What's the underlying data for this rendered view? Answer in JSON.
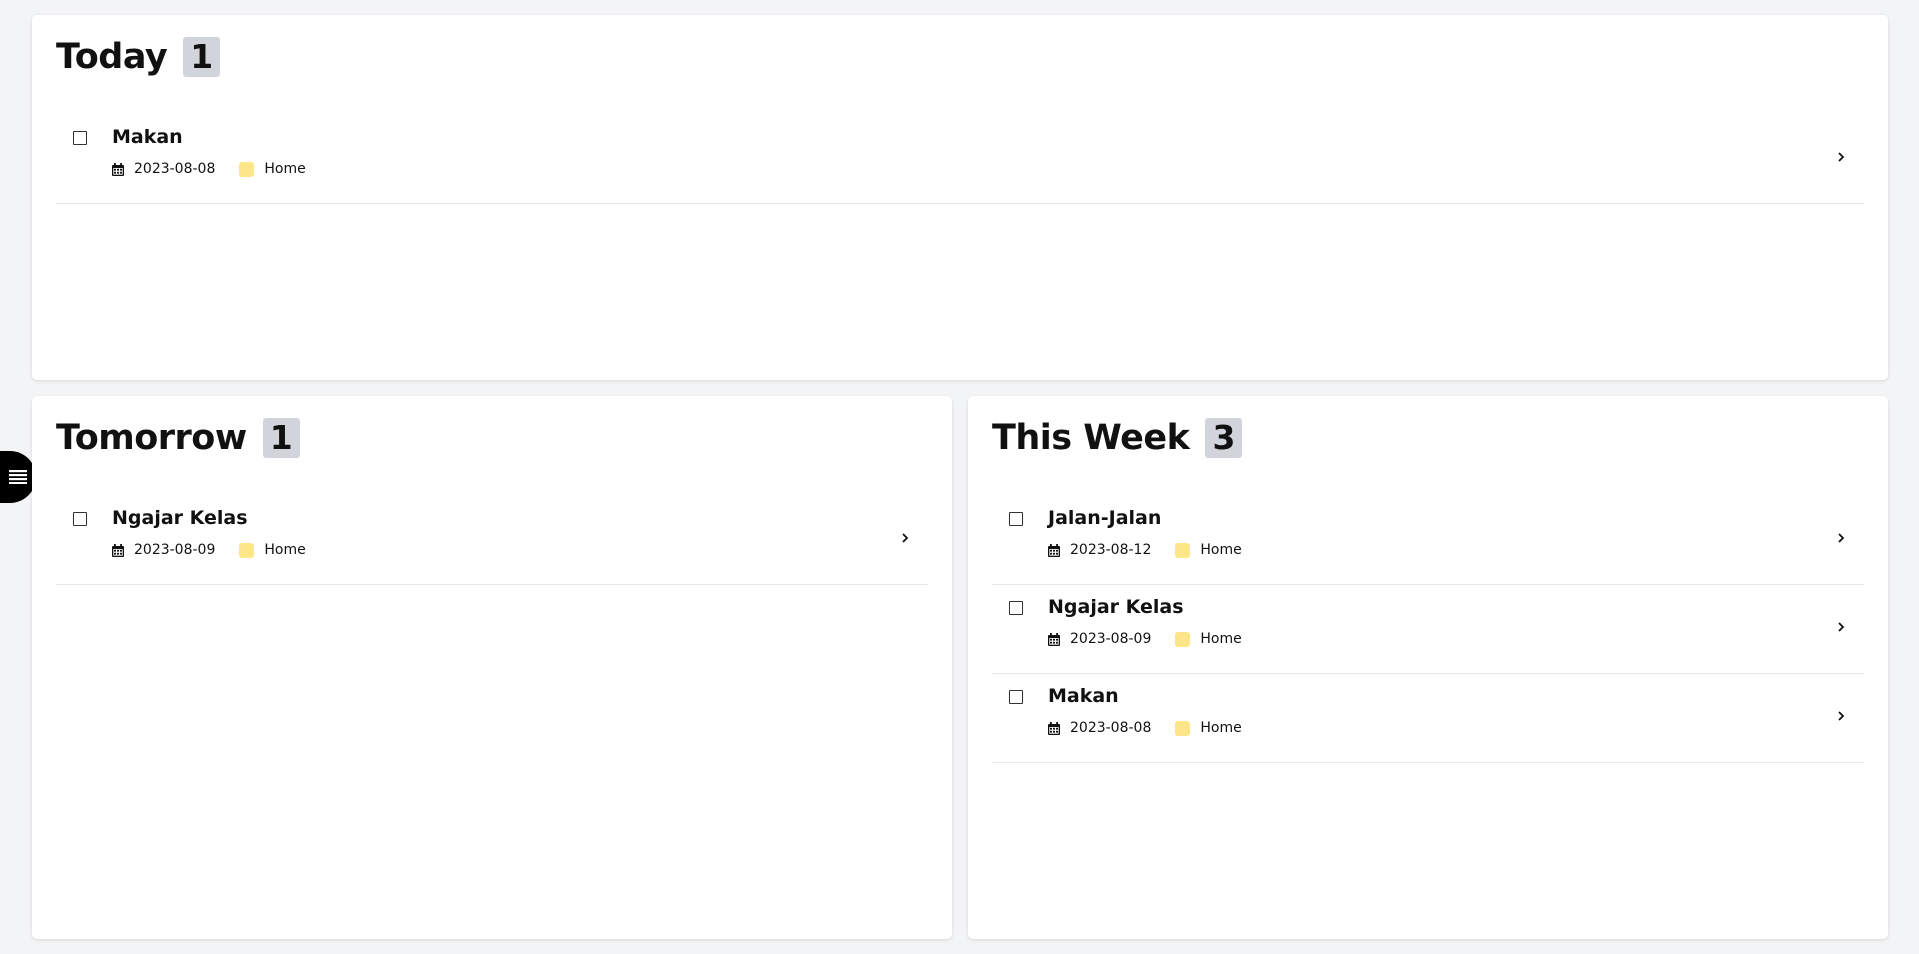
{
  "colors": {
    "page_background": "#f3f4f6",
    "panel_background": "#ffffff",
    "count_badge": "#d1d5db",
    "tag_home": "#fde68a",
    "sidebar_toggle": "#000000"
  },
  "sidebar_toggle": {
    "icon": "menu-icon"
  },
  "sections": {
    "today": {
      "title": "Today",
      "count": "1",
      "tasks": [
        {
          "title": "Makan",
          "date": "2023-08-08",
          "tag": "Home"
        }
      ]
    },
    "tomorrow": {
      "title": "Tomorrow",
      "count": "1",
      "tasks": [
        {
          "title": "Ngajar Kelas",
          "date": "2023-08-09",
          "tag": "Home"
        }
      ]
    },
    "this_week": {
      "title": "This Week",
      "count": "3",
      "tasks": [
        {
          "title": "Jalan-Jalan",
          "date": "2023-08-12",
          "tag": "Home"
        },
        {
          "title": "Ngajar Kelas",
          "date": "2023-08-09",
          "tag": "Home"
        },
        {
          "title": "Makan",
          "date": "2023-08-08",
          "tag": "Home"
        }
      ]
    }
  }
}
